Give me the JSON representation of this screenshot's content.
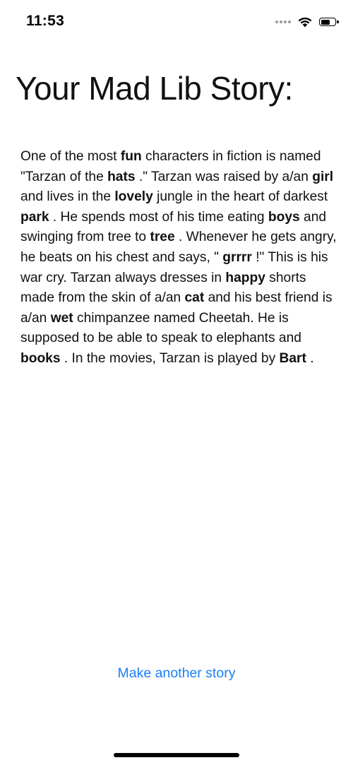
{
  "status_bar": {
    "time": "11:53",
    "icons": [
      "signal-dots-icon",
      "wifi-icon",
      "battery-icon"
    ],
    "battery_level": 0.7
  },
  "title": "Your Mad Lib Story:",
  "story": {
    "segments": [
      {
        "text": "One of the most ",
        "bold": false
      },
      {
        "text": "fun",
        "bold": true
      },
      {
        "text": " characters in fiction is named \"Tarzan of the ",
        "bold": false
      },
      {
        "text": "hats",
        "bold": true
      },
      {
        "text": " .\" Tarzan was raised by a/an ",
        "bold": false
      },
      {
        "text": "girl",
        "bold": true
      },
      {
        "text": " and lives in the ",
        "bold": false
      },
      {
        "text": "lovely",
        "bold": true
      },
      {
        "text": " jungle in the heart of darkest ",
        "bold": false
      },
      {
        "text": "park",
        "bold": true
      },
      {
        "text": " . He spends most of his time eating ",
        "bold": false
      },
      {
        "text": "boys",
        "bold": true
      },
      {
        "text": " and swinging from tree to ",
        "bold": false
      },
      {
        "text": "tree",
        "bold": true
      },
      {
        "text": " . Whenever he gets angry, he beats on his chest and says, \" ",
        "bold": false
      },
      {
        "text": "grrrr",
        "bold": true
      },
      {
        "text": " !\" This is his war cry. Tarzan always dresses in ",
        "bold": false
      },
      {
        "text": "happy",
        "bold": true
      },
      {
        "text": " shorts made from the skin of a/an ",
        "bold": false
      },
      {
        "text": "cat",
        "bold": true
      },
      {
        "text": " and his best friend is a/an ",
        "bold": false
      },
      {
        "text": "wet",
        "bold": true
      },
      {
        "text": " chimpanzee named Cheetah. He is supposed to be able to speak to elephants and ",
        "bold": false
      },
      {
        "text": "books",
        "bold": true
      },
      {
        "text": " . In the movies, Tarzan is played by ",
        "bold": false
      },
      {
        "text": "Bart",
        "bold": true
      },
      {
        "text": " .",
        "bold": false
      }
    ]
  },
  "actions": {
    "make_another_label": "Make another story"
  },
  "colors": {
    "accent": "#1a7ff5",
    "text": "#111111",
    "background": "#ffffff"
  }
}
